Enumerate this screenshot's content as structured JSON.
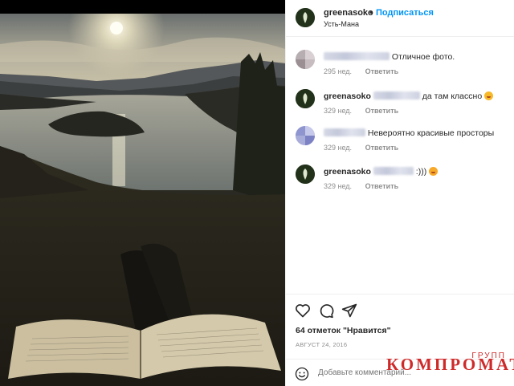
{
  "post": {
    "username": "greenasoko",
    "separator": "•",
    "follow_label": "Подписаться",
    "location": "Усть-Мана"
  },
  "comments": [
    {
      "user": "",
      "text": "Отличное фото.",
      "time": "295 нед.",
      "reply": "Ответить"
    },
    {
      "user": "greenasoko",
      "text": "да там классно",
      "time": "329 нед.",
      "reply": "Ответить"
    },
    {
      "user": "",
      "text": "Невероятно красивые просторы",
      "time": "329 нед.",
      "reply": "Ответить"
    },
    {
      "user": "greenasoko",
      "text": ":)))",
      "time": "329 нед.",
      "reply": "Ответить"
    }
  ],
  "likes_text": "64 отметок \"Нравится\"",
  "date_text": "АВГУСТ 24, 2016",
  "add_comment": {
    "placeholder": "Добавьте комментарий..."
  },
  "watermark": {
    "top": "ГРУПП",
    "main": "КОМПРОМАТ"
  },
  "icons": [
    "heart-icon",
    "comment-icon",
    "share-icon",
    "emoji-icon"
  ],
  "colors": {
    "accent": "#0095f6",
    "watermark": "#cf2a2a",
    "muted": "#8e8e8e"
  }
}
